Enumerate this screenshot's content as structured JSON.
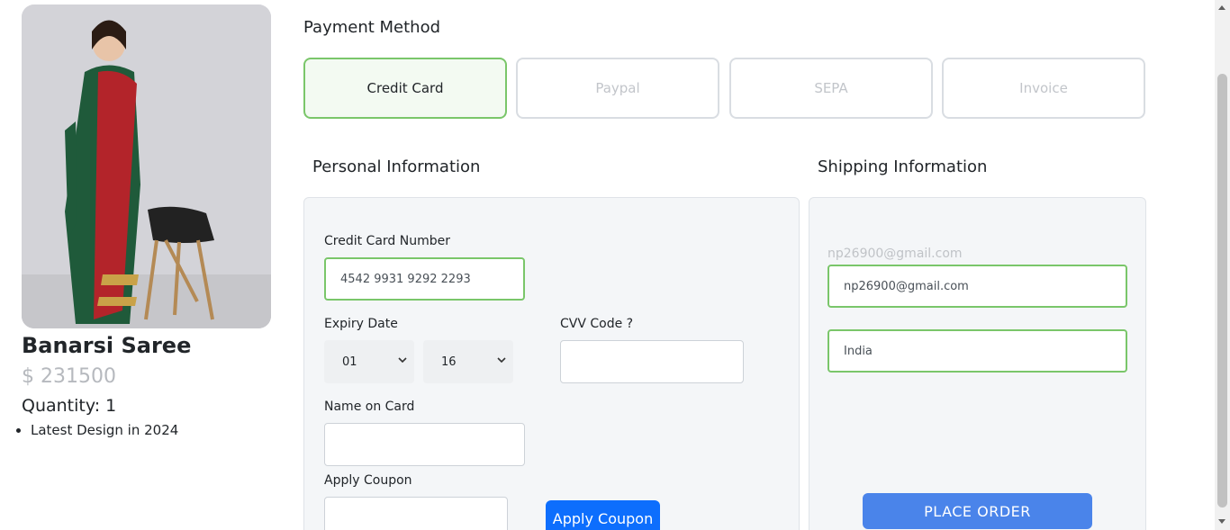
{
  "product": {
    "name": "Banarsi Saree",
    "price": "$ 231500",
    "quantity": "Quantity: 1",
    "features": [
      "Latest Design in 2024"
    ]
  },
  "payment": {
    "title": "Payment Method",
    "methods": [
      {
        "label": "Credit Card",
        "selected": true
      },
      {
        "label": "Paypal",
        "selected": false
      },
      {
        "label": "SEPA",
        "selected": false
      },
      {
        "label": "Invoice",
        "selected": false
      }
    ]
  },
  "personal": {
    "title": "Personal Information",
    "card_number_label": "Credit Card Number",
    "card_number_value": "4542 9931 9292 2293",
    "expiry_label": "Expiry Date",
    "expiry_month": "01",
    "expiry_year": "16",
    "cvv_label": "CVV Code ?",
    "cvv_value": "",
    "name_label": "Name on Card",
    "name_value": "",
    "coupon_label": "Apply Coupon",
    "coupon_value": "",
    "coupon_button": "Apply Coupon"
  },
  "shipping": {
    "title": "Shipping Information",
    "email_placeholder_floating": "np26900@gmail.com",
    "email_value": "np26900@gmail.com",
    "country_value": "India",
    "place_order_button": "PLACE ORDER"
  },
  "colors": {
    "accent_green": "#7ac66a",
    "primary_blue": "#0d6efd",
    "order_blue": "#4a84ea"
  }
}
